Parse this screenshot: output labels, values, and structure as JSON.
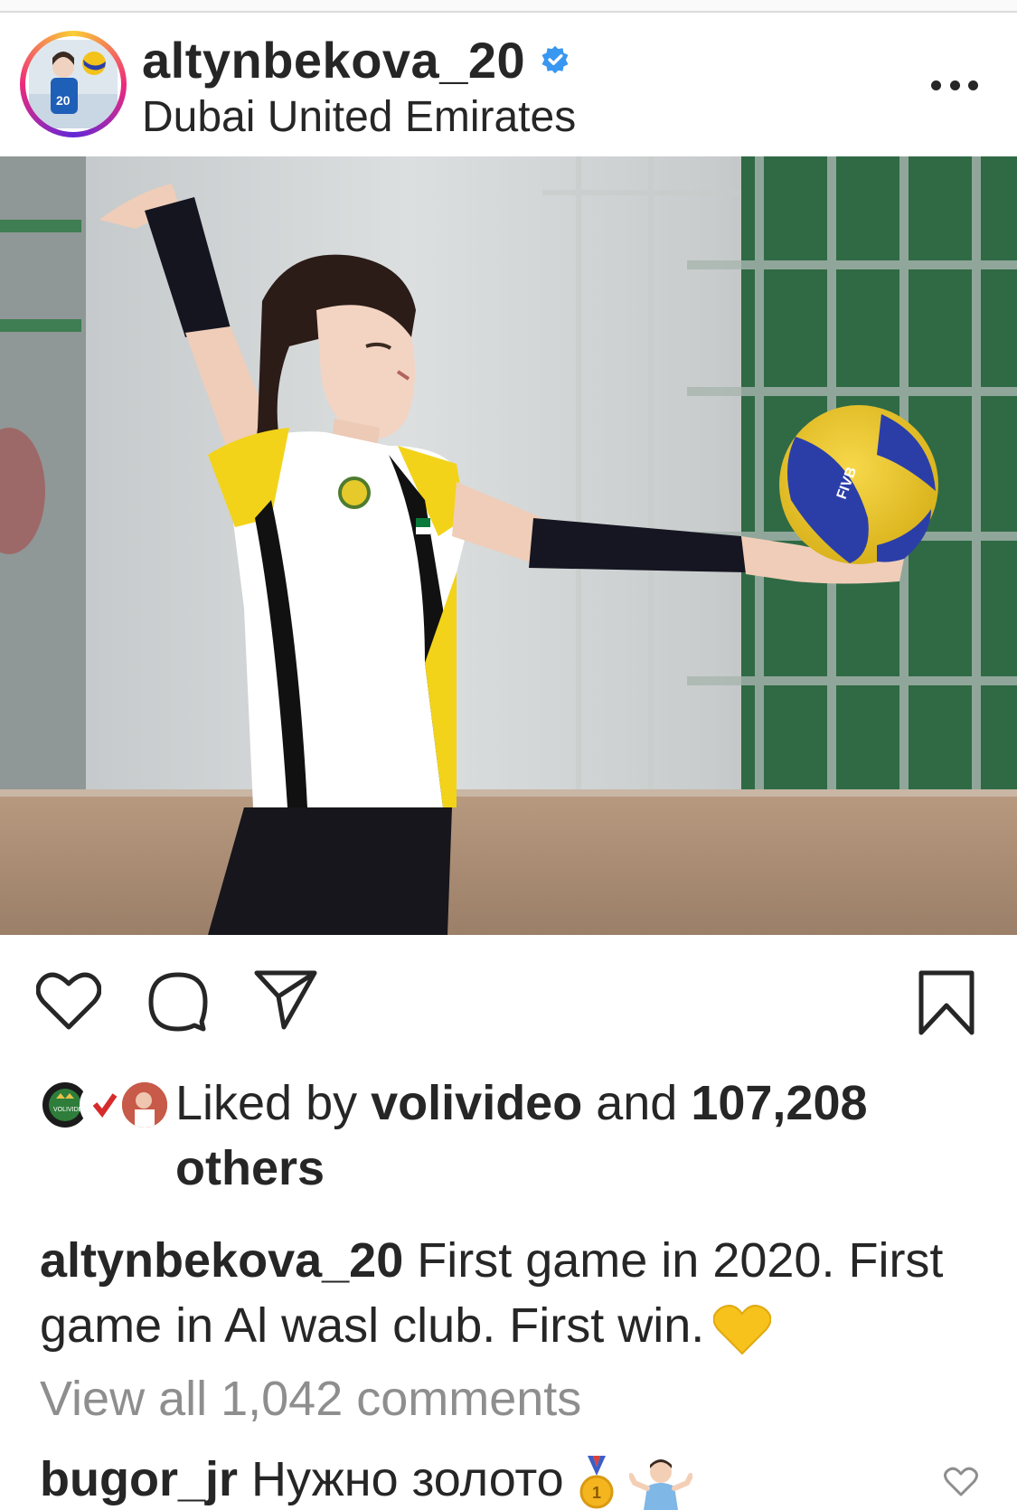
{
  "post": {
    "username": "altynbekova_20",
    "location": "Dubai United Emirates",
    "verified_icon": "verified-badge-icon",
    "more_icon": "more-options-icon"
  },
  "actions": {
    "like_icon": "heart-icon",
    "comment_icon": "comment-icon",
    "share_icon": "send-icon",
    "save_icon": "bookmark-icon"
  },
  "likes": {
    "prefix": "Liked by ",
    "first_user": "volivideo",
    "middle": " and ",
    "count": "107,208",
    "suffix": " others"
  },
  "caption": {
    "username": "altynbekova_20",
    "text": " First game in 2020. First game in Al wasl club. First win.",
    "emoji": "yellow-heart"
  },
  "comments": {
    "view_all": "View all 1,042 comments"
  },
  "top_comment": {
    "username": "bugor_jr",
    "text": " Нужно золото",
    "emojis": [
      "gold-medal",
      "person-shrugging"
    ]
  },
  "colors": {
    "text": "#262626",
    "secondary": "#8e8e8e",
    "verified": "#3897f0"
  }
}
